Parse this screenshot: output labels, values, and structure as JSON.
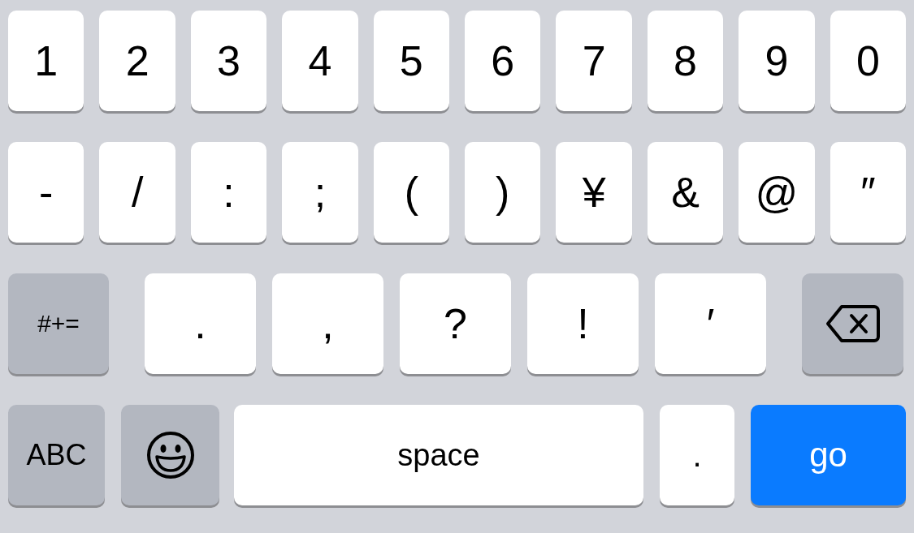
{
  "keyboard": {
    "rows": [
      {
        "keys": [
          {
            "kind": "char",
            "label": "1"
          },
          {
            "kind": "char",
            "label": "2"
          },
          {
            "kind": "char",
            "label": "3"
          },
          {
            "kind": "char",
            "label": "4"
          },
          {
            "kind": "char",
            "label": "5"
          },
          {
            "kind": "char",
            "label": "6"
          },
          {
            "kind": "char",
            "label": "7"
          },
          {
            "kind": "char",
            "label": "8"
          },
          {
            "kind": "char",
            "label": "9"
          },
          {
            "kind": "char",
            "label": "0"
          }
        ]
      },
      {
        "keys": [
          {
            "kind": "char",
            "label": "-"
          },
          {
            "kind": "char",
            "label": "/"
          },
          {
            "kind": "char",
            "label": ":"
          },
          {
            "kind": "char",
            "label": ";"
          },
          {
            "kind": "char",
            "label": "("
          },
          {
            "kind": "char",
            "label": ")"
          },
          {
            "kind": "char",
            "label": "¥"
          },
          {
            "kind": "char",
            "label": "&"
          },
          {
            "kind": "char",
            "label": "@"
          },
          {
            "kind": "char",
            "label": "″"
          }
        ]
      },
      {
        "keys": [
          {
            "kind": "mode",
            "label": "#+="
          },
          {
            "kind": "char",
            "label": "."
          },
          {
            "kind": "char",
            "label": ","
          },
          {
            "kind": "char",
            "label": "?"
          },
          {
            "kind": "char",
            "label": "!"
          },
          {
            "kind": "char",
            "label": "′"
          },
          {
            "kind": "delete"
          }
        ]
      },
      {
        "keys": [
          {
            "kind": "mode",
            "label": "ABC"
          },
          {
            "kind": "emoji"
          },
          {
            "kind": "space",
            "label": "space"
          },
          {
            "kind": "char",
            "label": "."
          },
          {
            "kind": "go",
            "label": "go"
          }
        ]
      }
    ]
  }
}
